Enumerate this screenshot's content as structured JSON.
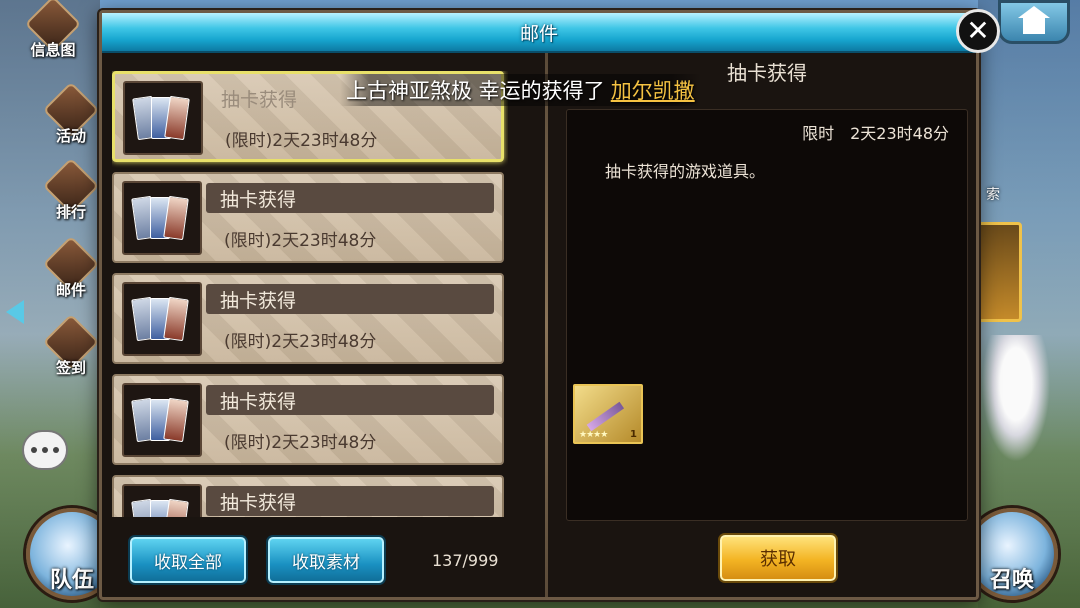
{
  "sidebar_left": [
    {
      "label": "信息图",
      "icon": "info-icon"
    },
    {
      "label": "活动",
      "icon": "event-icon"
    },
    {
      "label": "排行",
      "icon": "ranking-icon"
    },
    {
      "label": "邮件",
      "icon": "mail-icon"
    },
    {
      "label": "签到",
      "icon": "checkin-icon"
    }
  ],
  "bottom_left": {
    "label": "队伍"
  },
  "bottom_right": {
    "label": "召唤"
  },
  "right_partial_label": "索",
  "dialog": {
    "title": "邮件",
    "close_label": "✕",
    "mails": [
      {
        "title": "抽卡获得",
        "expire": "(限时)2天23时48分"
      },
      {
        "title": "抽卡获得",
        "expire": "(限时)2天23时48分"
      },
      {
        "title": "抽卡获得",
        "expire": "(限时)2天23时48分"
      },
      {
        "title": "抽卡获得",
        "expire": "(限时)2天23时48分"
      },
      {
        "title": "抽卡获得",
        "expire": ""
      }
    ],
    "buttons": {
      "collect_all": "收取全部",
      "collect_materials": "收取素材",
      "claim": "获取"
    },
    "count": "137/999",
    "detail": {
      "title": "抽卡获得",
      "expire": "限时　2天23时48分",
      "description": "抽卡获得的游戏道具。",
      "attachment": {
        "stars": "★★★★",
        "quantity": "1"
      }
    }
  },
  "notice": {
    "prefix": "上古神亚煞极 幸运的获得了",
    "highlight": "加尔凯撒"
  },
  "colors": {
    "header_cyan": "#17a6cf",
    "button_blue": "#1a91c2",
    "button_gold": "#f3b423",
    "highlight_gold": "#f5c242"
  }
}
